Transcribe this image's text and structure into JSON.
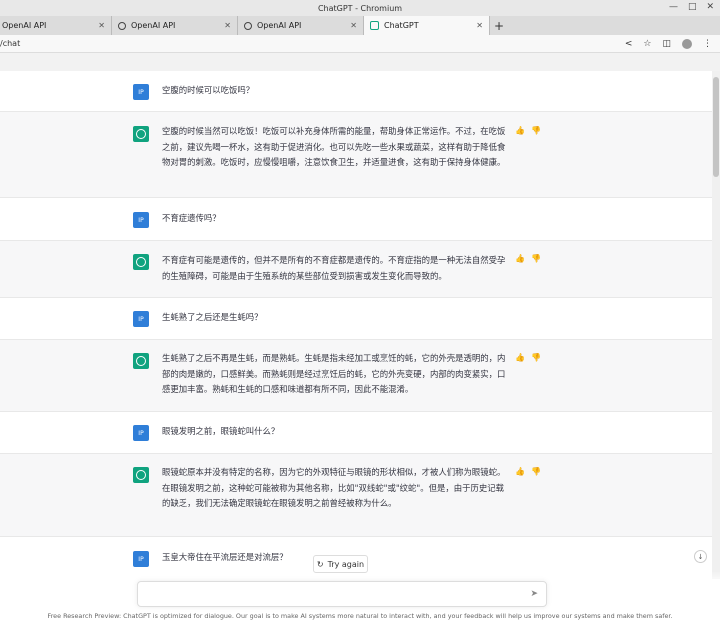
{
  "window": {
    "title": "ChatGPT - Chromium"
  },
  "tabs": [
    {
      "label": "OpenAI API"
    },
    {
      "label": "OpenAI API"
    },
    {
      "label": "OpenAI API"
    },
    {
      "label": "ChatGPT"
    }
  ],
  "address": {
    "url": "/chat"
  },
  "messages": [
    {
      "role": "user",
      "avatar": "IP",
      "text": "空腹的时候可以吃饭吗？"
    },
    {
      "role": "assistant",
      "text": "空腹的时候当然可以吃饭！吃饭可以补充身体所需的能量，帮助身体正常运作。不过，在吃饭之前，建议先喝一杯水，这有助于促进消化。也可以先吃一些水果或蔬菜，这样有助于降低食物对胃的刺激。吃饭时，应慢慢咀嚼，注意饮食卫生，并适量进食，这有助于保持身体健康。"
    },
    {
      "role": "user",
      "avatar": "IP",
      "text": "不育症遗传吗？"
    },
    {
      "role": "assistant",
      "text": "不育症有可能是遗传的，但并不是所有的不育症都是遗传的。不育症指的是一种无法自然受孕的生殖障碍，可能是由于生殖系统的某些部位受到损害或发生变化而导致的。"
    },
    {
      "role": "user",
      "avatar": "IP",
      "text": "生蚝熟了之后还是生蚝吗？"
    },
    {
      "role": "assistant",
      "text": "生蚝熟了之后不再是生蚝，而是熟蚝。生蚝是指未经加工或烹饪的蚝，它的外壳是透明的，内部的肉是嫩的，口感鲜美。而熟蚝则是经过烹饪后的蚝，它的外壳变硬，内部的肉变紧实，口感更加丰富。熟蚝和生蚝的口感和味道都有所不同，因此不能混淆。"
    },
    {
      "role": "user",
      "avatar": "IP",
      "text": "眼镜发明之前，眼镜蛇叫什么？"
    },
    {
      "role": "assistant",
      "text": "眼镜蛇原本并没有特定的名称，因为它的外观特征与眼镜的形状相似，才被人们称为眼镜蛇。在眼镜发明之前，这种蛇可能被称为其他名称，比如\"双线蛇\"或\"纹蛇\"。但是，由于历史记载的缺乏，我们无法确定眼镜蛇在眼镜发明之前曾经被称为什么。"
    },
    {
      "role": "user",
      "avatar": "IP",
      "text": "玉皇大帝住在平流层还是对流层？"
    }
  ],
  "controls": {
    "try_again": "Try again",
    "input_placeholder": ""
  },
  "footer": "Free Research Preview: ChatGPT is optimized for dialogue. Our goal is to make AI systems more natural to interact with, and your feedback will help us improve our systems and make them safer.",
  "icons": {
    "thumbs_up": "thumbs-up-icon",
    "thumbs_down": "thumbs-down-icon",
    "send": "send-icon",
    "retry": "refresh-icon"
  }
}
